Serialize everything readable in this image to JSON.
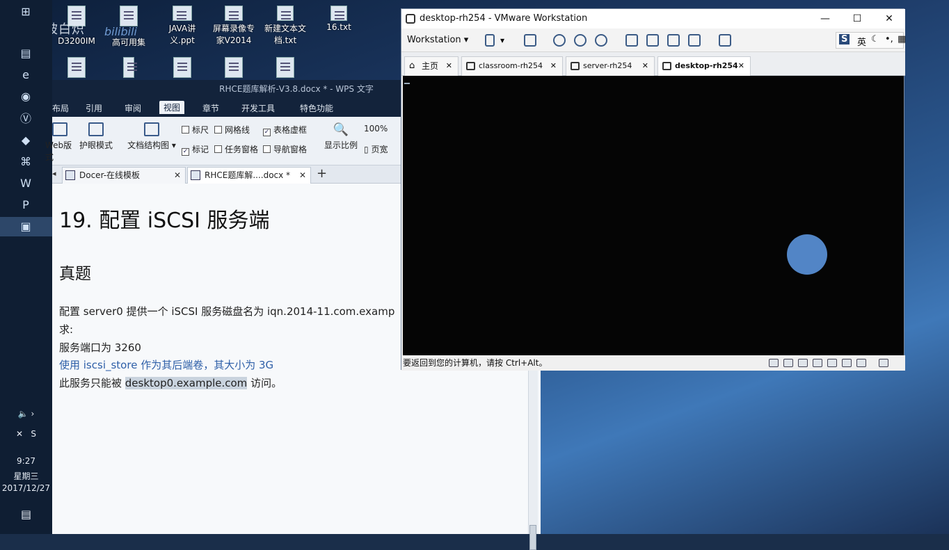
{
  "desktop": {
    "watermark": "温馨被白炽",
    "watermark_brand": "bilibili",
    "icons": [
      {
        "label": "D3200IM",
        "icon": "file-icon"
      },
      {
        "label": "高可用集",
        "icon": "file-icon"
      },
      {
        "label": "JAVA讲义.ppt",
        "icon": "ppt-file-icon"
      },
      {
        "label": "屏幕录像专家V2014",
        "icon": "recorder-app-icon"
      },
      {
        "label": "新建文本文档.txt",
        "icon": "txt-file-icon"
      },
      {
        "label": "16.txt",
        "icon": "txt-file-icon"
      }
    ]
  },
  "taskbar": {
    "icons": [
      "windows-start-icon",
      "folder-icon",
      "ie-icon",
      "browser-icon",
      "vc-icon",
      "app-icon",
      "network-icon",
      "wps-w-icon",
      "wps-p-icon",
      "vmware-icon"
    ],
    "tray": {
      "time": "9:27",
      "weekday": "星期三",
      "date": "2017/12/27"
    }
  },
  "wps": {
    "title": "RHCE题库解析-V3.8.docx * - WPS 文字",
    "menu": [
      "布局",
      "引用",
      "审阅",
      "视图",
      "章节",
      "开发工具",
      "特色功能"
    ],
    "active_menu": "视图",
    "ribbon": {
      "buttons": [
        "Web版式",
        "护眼模式",
        "文档结构图",
        "显示比例",
        "页宽"
      ],
      "zoom": "100%",
      "checkboxes": [
        {
          "label": "标尺",
          "checked": false
        },
        {
          "label": "网格线",
          "checked": false
        },
        {
          "label": "表格虚框",
          "checked": true
        },
        {
          "label": "标记",
          "checked": true
        },
        {
          "label": "任务窗格",
          "checked": false
        },
        {
          "label": "导航窗格",
          "checked": false
        }
      ]
    },
    "tabs": [
      {
        "label": "Docer-在线模板"
      },
      {
        "label": "RHCE题库解....docx *"
      }
    ],
    "new_tab": "+",
    "document": {
      "heading": "19. 配置 iSCSI 服务端",
      "subheading": "真题",
      "lines": [
        "配置 server0 提供一个 iSCSI 服务磁盘名为 iqn.2014-11.com.examp",
        "求:",
        "服务端口为 3260",
        "使用 iscsi_store 作为其后端卷，其大小为 3G",
        "此服务只能被 desktop0.example.com 访问。"
      ],
      "link_line_pre": "此服务只能被 ",
      "link_text": "desktop0.example.com",
      "link_line_post": " 访问。"
    }
  },
  "vmware": {
    "title": "desktop-rh254 - VMware Workstation",
    "menu_label": "Workstation",
    "ime": {
      "lang": "英"
    },
    "tabs": [
      {
        "label": "主页",
        "icon": "home-icon",
        "active": false
      },
      {
        "label": "classroom-rh254",
        "icon": "vm-icon",
        "active": false
      },
      {
        "label": "server-rh254",
        "icon": "vm-icon",
        "active": false
      },
      {
        "label": "desktop-rh254",
        "icon": "vm-icon",
        "active": true
      }
    ],
    "status": "要返回到您的计算机，请按 Ctrl+Alt。",
    "colors": {
      "screen": "#050505",
      "circle": "#5285c6"
    }
  }
}
